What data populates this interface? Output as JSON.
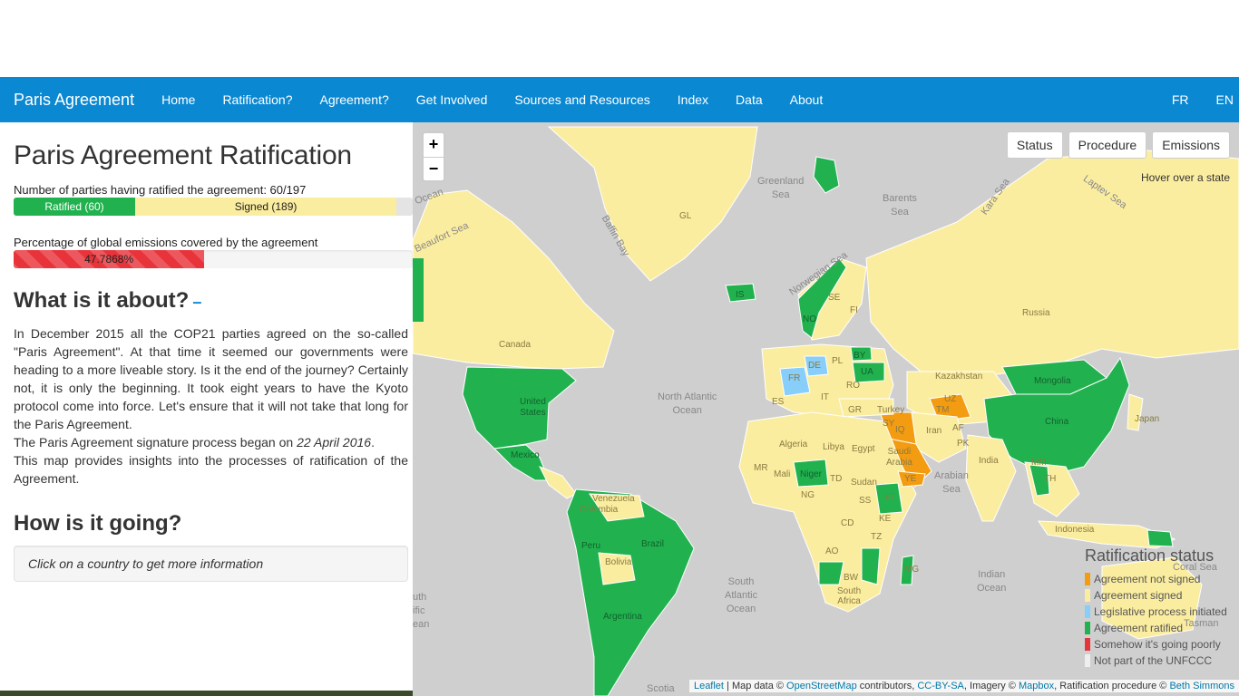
{
  "navbar": {
    "brand": "Paris Agreement",
    "items": [
      "Home",
      "Ratification?",
      "Agreement?",
      "Get Involved",
      "Sources and Resources",
      "Index",
      "Data",
      "About"
    ],
    "lang": [
      "FR",
      "EN"
    ]
  },
  "sidebar": {
    "title": "Paris Agreement Ratification",
    "parties_label": "Number of parties having ratified the agreement: 60/197",
    "ratified_label": "Ratified (60)",
    "signed_label": "Signed (189)",
    "ratified_value": 60,
    "signed_value": 189,
    "total_parties": 197,
    "emissions_label": "Percentage of global emissions covered by the agreement",
    "emissions_value_text": "47.7868%",
    "emissions_value": 47.7868,
    "about_heading": "What is it about?",
    "collapse_symbol": "–",
    "about_text": "In December 2015 all the COP21 parties agreed on the so-called \"Paris Agreement\". At that time it seemed our governments were heading to a more liveable story. Is it the end of the journey? Certainly not, it is only the beginning. It took eight years to have the Kyoto protocol come into force. Let's ensure that it will not take that long for the Paris Agreement.",
    "signature_prefix": "The Paris Agreement signature process began on ",
    "signature_date": "22 April 2016",
    "signature_suffix": ".",
    "insights_text": "This map provides insights into the processes of ratification of the Agreement.",
    "going_heading": "How is it going?",
    "click_info": "Click on a country to get more information"
  },
  "map": {
    "zoom_in": "+",
    "zoom_out": "−",
    "mode_buttons": [
      "Status",
      "Procedure",
      "Emissions"
    ],
    "hover_info": "Hover over a state",
    "legend_title": "Ratification status",
    "legend": [
      {
        "label": "Agreement not signed",
        "color": "#f39c12"
      },
      {
        "label": "Agreement signed",
        "color": "#fbeda0"
      },
      {
        "label": "Legislative process initiated",
        "color": "#87cefa"
      },
      {
        "label": "Agreement ratified",
        "color": "#21b24f"
      },
      {
        "label": "Somehow it's going poorly",
        "color": "#e8333a"
      },
      {
        "label": "Not part of the UNFCCC",
        "color": "#eeeeee"
      }
    ],
    "attribution": {
      "leaflet": "Leaflet",
      "sep1": " | Map data © ",
      "osm": "OpenStreetMap",
      "sep2": " contributors, ",
      "ccbysa": "CC-BY-SA",
      "sep3": ", Imagery © ",
      "mapbox": "Mapbox",
      "sep4": ", Ratification procedure © ",
      "beth": "Beth Simmons"
    },
    "sea_labels": {
      "north_atlantic": "North Atlantic\nOcean",
      "south_atlantic": "South\nAtlantic\nOcean",
      "indian": "Indian\nOcean",
      "arabian": "Arabian\nSea",
      "greenland": "Greenland\nSea",
      "barents": "Barents\nSea",
      "norwegian": "Norwegian Sea",
      "kara": "Kara Sea",
      "laptev": "Laptev Sea",
      "baffin": "Baffin Bay",
      "beaufort": "Beaufort Sea",
      "coral": "Coral Sea",
      "ocean_top": "Ocean",
      "scotia": "Scotia",
      "tasman": "Tasman",
      "south_pacific": "uth\nific\nean"
    },
    "country_labels": {
      "canada": "Canada",
      "us": "United\nStates",
      "mexico": "Mexico",
      "brazil": "Brazil",
      "russia": "Russia",
      "china": "China",
      "mongolia": "Mongolia",
      "kazakhstan": "Kazakhstan",
      "india": "India",
      "iran": "Iran",
      "algeria": "Algeria",
      "libya": "Libya",
      "egypt": "Egypt",
      "sudan": "Sudan",
      "niger": "Niger",
      "mali": "Mali",
      "saudi": "Saudi\nArabia",
      "argentina": "Argentina",
      "bolivia": "Bolivia",
      "peru": "Peru",
      "colombia": "Colombia",
      "venezuela": "Venezuela",
      "turkey": "Turkey",
      "japan": "Japan",
      "indonesia": "Indonesia",
      "gl": "GL",
      "is": "IS",
      "no": "NO",
      "se": "SE",
      "fi": "FI",
      "fr": "FR",
      "de": "DE",
      "pl": "PL",
      "ua": "UA",
      "by": "BY",
      "es": "ES",
      "ro": "RO",
      "gr": "GR",
      "it": "IT",
      "af": "AF",
      "pk": "PK",
      "tm": "TM",
      "uz": "UZ",
      "iq": "IQ",
      "sy": "SY",
      "ye": "YE",
      "mr": "MR",
      "td": "TD",
      "ng": "NG",
      "cd": "CD",
      "ao": "AO",
      "bw": "BW",
      "tz": "TZ",
      "ke": "KE",
      "et": "ET",
      "ss": "SS",
      "mg": "MG",
      "mm": "MM",
      "th": "TH",
      "south_africa": "South\nAfrica"
    }
  }
}
